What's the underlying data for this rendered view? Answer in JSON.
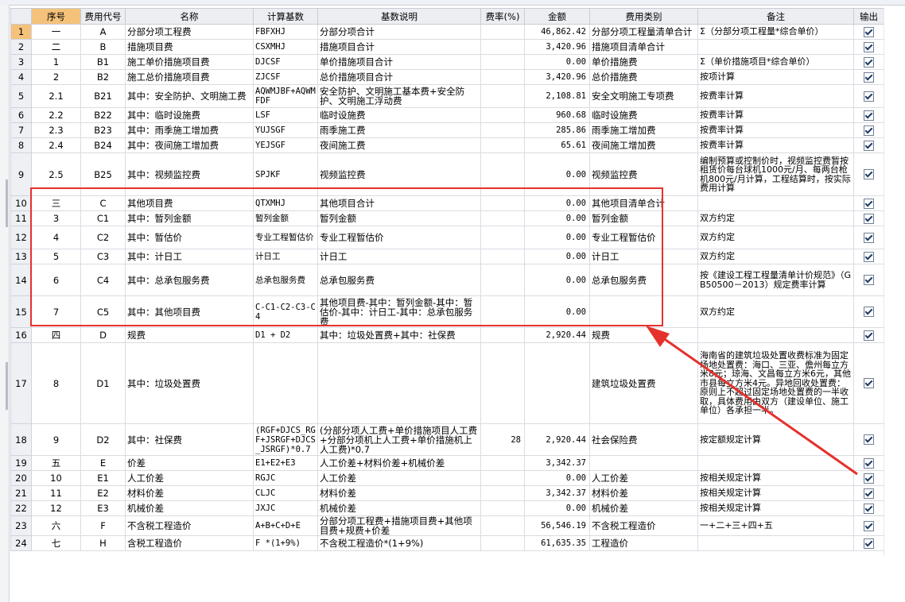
{
  "columns": [
    "",
    "序号",
    "费用代号",
    "名称",
    "计算基数",
    "基数说明",
    "费率(%)",
    "金额",
    "费用类别",
    "备注",
    "输出"
  ],
  "rows": [
    {
      "n": "1",
      "seq": "一",
      "code": "A",
      "name": "分部分项工程费",
      "base": "FBFXHJ",
      "desc": "分部分项合计",
      "rate": "",
      "amount": "46,862.42",
      "cat": "分部分项工程量清单合计",
      "note": "Σ（分部分项工程量*综合单价）"
    },
    {
      "n": "2",
      "seq": "二",
      "code": "B",
      "name": "措施项目费",
      "base": "CSXMHJ",
      "desc": "措施项目合计",
      "rate": "",
      "amount": "3,420.96",
      "cat": "措施项目清单合计",
      "note": ""
    },
    {
      "n": "3",
      "seq": "1",
      "code": "B1",
      "name": "施工单价措施项目费",
      "base": "DJCSF",
      "desc": "单价措施项目合计",
      "rate": "",
      "amount": "0.00",
      "cat": "单价措施费",
      "note": "Σ（单价措施项目*综合单价）"
    },
    {
      "n": "4",
      "seq": "2",
      "code": "B2",
      "name": "施工总价措施项目费",
      "base": "ZJCSF",
      "desc": "总价措施项目合计",
      "rate": "",
      "amount": "3,420.96",
      "cat": "总价措施费",
      "note": "按项计算"
    },
    {
      "n": "5",
      "seq": "2.1",
      "code": "B21",
      "name": "其中：安全防护、文明施工费",
      "base": "AQWMJBF+AQWMFDF",
      "desc": "安全防护、文明施工基本费+安全防护、文明施工浮动费",
      "rate": "",
      "amount": "2,108.81",
      "cat": "安全文明施工专项费",
      "note": "按费率计算"
    },
    {
      "n": "6",
      "seq": "2.2",
      "code": "B22",
      "name": "其中：临时设施费",
      "base": "LSF",
      "desc": "临时设施费",
      "rate": "",
      "amount": "960.68",
      "cat": "临时设施费",
      "note": "按费率计算"
    },
    {
      "n": "7",
      "seq": "2.3",
      "code": "B23",
      "name": "其中：雨季施工增加费",
      "base": "YUJSGF",
      "desc": "雨季施工费",
      "rate": "",
      "amount": "285.86",
      "cat": "雨季施工增加费",
      "note": "按费率计算"
    },
    {
      "n": "8",
      "seq": "2.4",
      "code": "B24",
      "name": "其中：夜间施工增加费",
      "base": "YEJSGF",
      "desc": "夜间施工费",
      "rate": "",
      "amount": "65.61",
      "cat": "夜间施工增加费",
      "note": "按费率计算"
    },
    {
      "n": "9",
      "seq": "2.5",
      "code": "B25",
      "name": "其中：视频监控费",
      "base": "SPJKF",
      "desc": "视频监控费",
      "rate": "",
      "amount": "0.00",
      "cat": "视频监控费",
      "note": "编制预算或控制价时，视频监控费暂按租赁价每台球机1000元/月、每两台枪机800元/月计算，工程结算时，按实际费用计算"
    },
    {
      "n": "10",
      "seq": "三",
      "code": "C",
      "name": "其他项目费",
      "base": "QTXMHJ",
      "desc": "其他项目合计",
      "rate": "",
      "amount": "0.00",
      "cat": "其他项目清单合计",
      "note": ""
    },
    {
      "n": "11",
      "seq": "3",
      "code": "C1",
      "name": "其中：暂列金额",
      "base": "暂列金额",
      "desc": "暂列金额",
      "rate": "",
      "amount": "0.00",
      "cat": "暂列金额",
      "note": "双方约定"
    },
    {
      "n": "12",
      "seq": "4",
      "code": "C2",
      "name": "其中：暂估价",
      "base": "专业工程暂估价",
      "desc": "专业工程暂估价",
      "rate": "",
      "amount": "0.00",
      "cat": "专业工程暂估价",
      "note": "双方约定"
    },
    {
      "n": "13",
      "seq": "5",
      "code": "C3",
      "name": "其中：计日工",
      "base": "计日工",
      "desc": "计日工",
      "rate": "",
      "amount": "0.00",
      "cat": "计日工",
      "note": "双方约定"
    },
    {
      "n": "14",
      "seq": "6",
      "code": "C4",
      "name": "其中：总承包服务费",
      "base": "总承包服务费",
      "desc": "总承包服务费",
      "rate": "",
      "amount": "0.00",
      "cat": "总承包服务费",
      "note": "按《建设工程工程量清单计价规范》（GB50500－2013）规定费率计算"
    },
    {
      "n": "15",
      "seq": "7",
      "code": "C5",
      "name": "其中：其他项目费",
      "base": "C-C1-C2-C3-C4",
      "desc": "其他项目费-其中：暂列金额-其中：暂估价-其中：计日工-其中：总承包服务费",
      "rate": "",
      "amount": "0.00",
      "cat": "",
      "note": "双方约定"
    },
    {
      "n": "16",
      "seq": "四",
      "code": "D",
      "name": "规费",
      "base": "D1 + D2",
      "desc": "其中：垃圾处置费+其中：社保费",
      "rate": "",
      "amount": "2,920.44",
      "cat": "规费",
      "note": ""
    },
    {
      "n": "17",
      "seq": "8",
      "code": "D1",
      "name": "其中：垃圾处置费",
      "base": "",
      "desc": "",
      "rate": "",
      "amount": "",
      "cat": "建筑垃圾处置费",
      "note": "海南省的建筑垃圾处置收费标准为固定场地处置费：海口、三亚、儋州每立方米8元；琼海、文昌每立方米6元，其他市县每立方米4元。异地回收处置费：原则上不超过固定场地处置费的一半收取，具体费用由双方（建设单位、施工单位）各承担一半。"
    },
    {
      "n": "18",
      "seq": "9",
      "code": "D2",
      "name": "其中：社保费",
      "base": "(RGF+DJCS_RGF+JSRGF+DJCS_JSRGF)*0.7",
      "desc": "(分部分项人工费+单价措施项目人工费+分部分项机上人工费+单价措施机上人工费)*0.7",
      "rate": "28",
      "amount": "2,920.44",
      "cat": "社会保险费",
      "note": "按定额规定计算"
    },
    {
      "n": "19",
      "seq": "五",
      "code": "E",
      "name": "价差",
      "base": "E1+E2+E3",
      "desc": "人工价差+材料价差+机械价差",
      "rate": "",
      "amount": "3,342.37",
      "cat": "",
      "note": ""
    },
    {
      "n": "20",
      "seq": "10",
      "code": "E1",
      "name": "人工价差",
      "base": "RGJC",
      "desc": "人工价差",
      "rate": "",
      "amount": "0.00",
      "cat": "人工价差",
      "note": "按相关规定计算"
    },
    {
      "n": "21",
      "seq": "11",
      "code": "E2",
      "name": "材料价差",
      "base": "CLJC",
      "desc": "材料价差",
      "rate": "",
      "amount": "3,342.37",
      "cat": "材料价差",
      "note": "按相关规定计算"
    },
    {
      "n": "22",
      "seq": "12",
      "code": "E3",
      "name": "机械价差",
      "base": "JXJC",
      "desc": "机械价差",
      "rate": "",
      "amount": "0.00",
      "cat": "机械价差",
      "note": "按相关规定计算"
    },
    {
      "n": "23",
      "seq": "六",
      "code": "F",
      "name": "不含税工程造价",
      "base": "A+B+C+D+E",
      "desc": "分部分项工程费+措施项目费+其他项目费+规费+价差",
      "rate": "",
      "amount": "56,546.19",
      "cat": "不含税工程造价",
      "note": "一+二+三+四+五"
    },
    {
      "n": "24",
      "seq": "七",
      "code": "H",
      "name": "含税工程造价",
      "base": "F *(1+9%)",
      "desc": "不含税工程造价*(1+9%)",
      "rate": "",
      "amount": "61,635.35",
      "cat": "工程造价",
      "note": ""
    }
  ],
  "colors": {
    "highlight": "#e5312c",
    "header_bg": "#eceef2",
    "selected": "#f4c27a"
  }
}
